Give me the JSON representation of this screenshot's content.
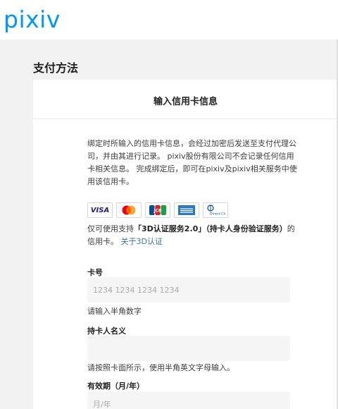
{
  "header": {
    "logo": "pixiv"
  },
  "page": {
    "section_title": "支付方法"
  },
  "card": {
    "title": "输入信用卡信息",
    "description": "绑定时所输入的信用卡信息，会经过加密后发送至支付代理公司，并由其进行记录。 pixiv股份有限公司不会记录任何信用卡相关信息。 完成绑定后，即可在pixiv及pixiv相关服务中使用该信用卡。",
    "brands": [
      "VISA",
      "Mastercard",
      "JCB",
      "American Express",
      "Diners Club"
    ],
    "support_prefix": "仅可使用支持",
    "support_bold": "「3D认证服务2.0」（持卡人身份验证服务）",
    "support_suffix": "的信用卡。",
    "support_link": "关于3D认证"
  },
  "form": {
    "card_number": {
      "label": "卡号",
      "placeholder": "1234 1234 1234 1234",
      "hint": "请输入半角数字"
    },
    "holder": {
      "label": "持卡人名义",
      "placeholder": "",
      "hint": "请按照卡面所示，使用半角英文字母输入。"
    },
    "expiry": {
      "label": "有效期（月/年）",
      "placeholder": "月/年"
    }
  }
}
